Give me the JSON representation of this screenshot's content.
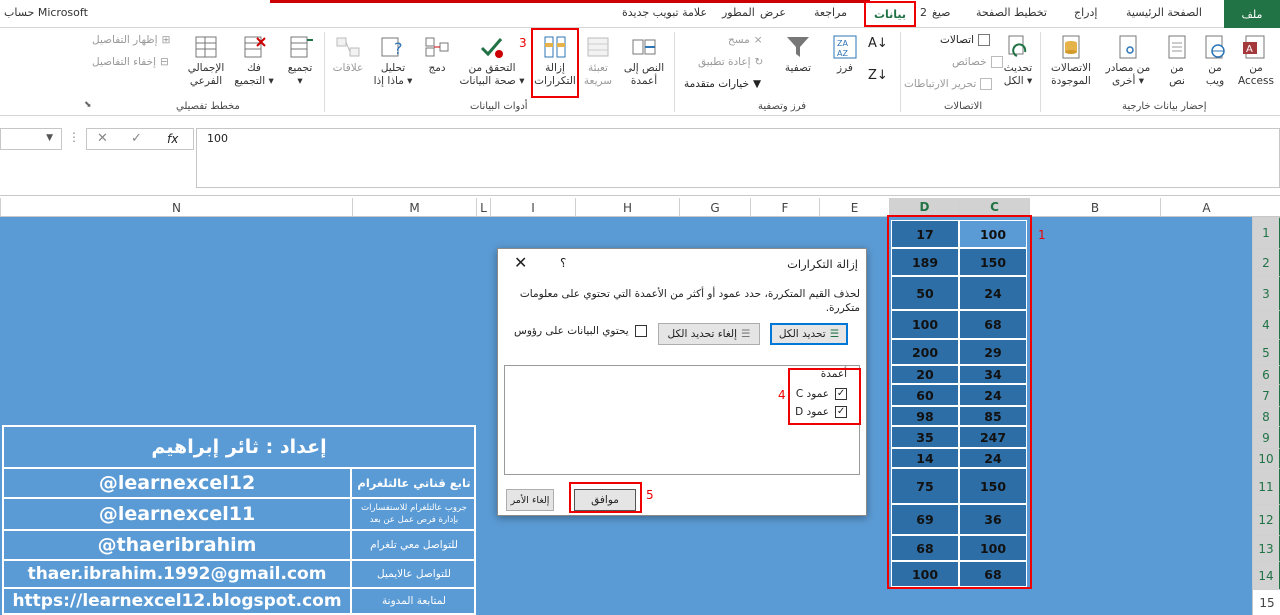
{
  "tabs": {
    "file": "ملف",
    "home": "الصفحة الرئيسية",
    "insert": "إدراج",
    "layout": "تخطيط الصفحة",
    "formulas": "صيغ",
    "formulas_step": "2",
    "data": "بيانات",
    "review": "مراجعة",
    "view": "عرض",
    "developer": "المطور",
    "newtab": "علامة تبويب جديدة",
    "account": "حساب Microsoft"
  },
  "ribbon": {
    "ext_group": "إحضار بيانات خارجية",
    "ext_access": [
      "من",
      "Access"
    ],
    "ext_web": [
      "من",
      "ويب"
    ],
    "ext_text": [
      "من",
      "نص"
    ],
    "ext_other": [
      "من مصادر",
      "أخرى ▾"
    ],
    "ext_existing": [
      "الاتصالات",
      "الموجودة"
    ],
    "conn_group": "الاتصالات",
    "conn_refresh": [
      "تحديث",
      "الكل ▾"
    ],
    "conn_connections": "اتصالات",
    "conn_props": "خصائص",
    "conn_edit": "تحرير الارتباطات",
    "sort_group": "فرز وتصفية",
    "sort_sort": "فرز",
    "sort_filter": "تصفية",
    "sort_clear": "مسح",
    "sort_reapply": "إعادة تطبيق",
    "sort_adv": "خيارات متقدمة",
    "tools_group": "أدوات البيانات",
    "tools_t2c": [
      "النص إلى",
      "أعمدة"
    ],
    "tools_flash": [
      "تعبئة",
      "سريعة"
    ],
    "tools_remove": [
      "إزالة",
      "التكرارات"
    ],
    "tools_remove_step": "3",
    "tools_valid": [
      "التحقق من",
      "صحة البيانات ▾"
    ],
    "tools_consol": "دمج",
    "tools_whatif": [
      "تحليل",
      "ماذا إذا ▾"
    ],
    "tools_rel": "علاقات",
    "outline_group": "مخطط تفصيلي",
    "outline_group_btn": [
      "تجميع",
      "▾"
    ],
    "outline_ungroup": [
      "فك",
      "التجميع ▾"
    ],
    "outline_subtotal": [
      "الإجمالي",
      "الفرعي"
    ],
    "outline_show": "إظهار التفاصيل",
    "outline_hide": "إخفاء التفاصيل"
  },
  "formula_bar": {
    "value": "100",
    "fx": "fx"
  },
  "columns": [
    "A",
    "B",
    "C",
    "D",
    "E",
    "F",
    "G",
    "H",
    "I",
    "L",
    "M",
    "N"
  ],
  "rows": [
    "1",
    "2",
    "3",
    "4",
    "5",
    "6",
    "7",
    "8",
    "9",
    "10",
    "11",
    "12",
    "13",
    "14",
    "15"
  ],
  "data_col_d": [
    "17",
    "189",
    "50",
    "100",
    "200",
    "20",
    "60",
    "98",
    "35",
    "14",
    "75",
    "69",
    "68",
    "100"
  ],
  "data_col_c": [
    "100",
    "150",
    "24",
    "68",
    "29",
    "34",
    "24",
    "85",
    "247",
    "24",
    "150",
    "36",
    "100",
    "68"
  ],
  "annotations": {
    "step1": "1",
    "step4": "4",
    "step5": "5"
  },
  "info": {
    "title": "إعداد : ثائر إبراهيم",
    "rows": [
      {
        "value": "@learnexcel12",
        "label": "تابع قناتي عالتلغرام"
      },
      {
        "value": "@learnexcel11",
        "label": "جروب عالتلغرام للاستفسارات بإدارة فرص عمل عن بعد"
      },
      {
        "value": "@thaeribrahim",
        "label": "للتواصل معي تلغرام"
      },
      {
        "value": "thaer.ibrahim.1992@gmail.com",
        "label": "للتواصل عالايميل"
      },
      {
        "value": "https://learnexcel12.blogspot.com",
        "label": "لمتابعة المدونة"
      }
    ]
  },
  "dialog": {
    "title": "إزالة التكرارات",
    "help": "؟",
    "close": "✕",
    "description": "لحذف القيم المتكررة، حدد عمود أو أكثر من الأعمدة التي تحتوي على معلومات متكررة.",
    "select_all": "تحديد الكل",
    "unselect_all": "إلغاء تحديد الكل",
    "headers_label": "يحتوي البيانات على رؤوس",
    "columns_caption": "أعمدة",
    "col_c": "عمود C",
    "col_d": "عمود D",
    "ok": "موافق",
    "cancel": "إلغاء الأمر"
  }
}
